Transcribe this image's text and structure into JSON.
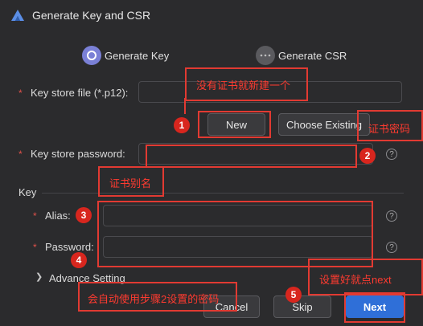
{
  "window": {
    "title": "Generate Key and CSR"
  },
  "steps": [
    {
      "label": "Generate Key"
    },
    {
      "label": "Generate CSR"
    }
  ],
  "form": {
    "keystore_file_label": "Key store file (*.p12):",
    "new_label": "New",
    "choose_existing_label": "Choose Existing",
    "keystore_password_label": "Key store password:",
    "key_section_label": "Key",
    "alias_label": "Alias:",
    "password_label": "Password:",
    "advance_setting_label": "Advance Setting",
    "required_mark": "*",
    "help_glyph": "?"
  },
  "footer": {
    "cancel_label": "Cancel",
    "skip_label": "Skip",
    "next_label": "Next"
  },
  "annotations": {
    "a1_text": "没有证书就新建一个",
    "a2_text": "证书密码",
    "a3_text": "证书别名",
    "a4_text": "会自动使用步骤2设置的密码",
    "a5_text": "设置好就点next",
    "num1": "1",
    "num2": "2",
    "num3": "3",
    "num4": "4",
    "num5": "5",
    "color": "#e23a32"
  },
  "colors": {
    "background": "#2b2b2d",
    "primary": "#2f6fd8",
    "step_active": "#7a80d6"
  }
}
